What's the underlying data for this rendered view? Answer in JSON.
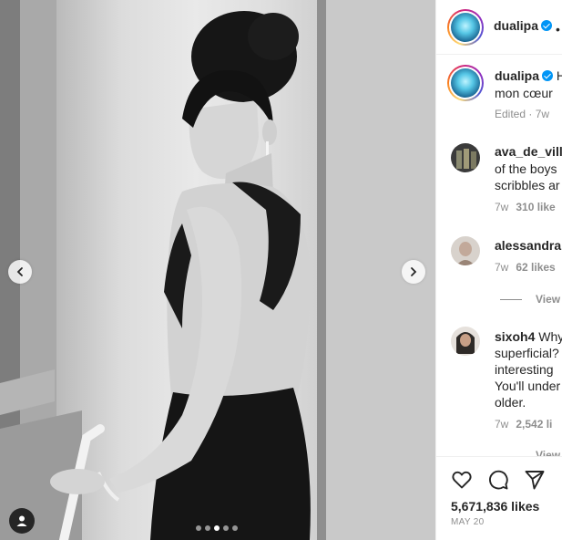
{
  "post": {
    "author": "dualipa",
    "verified": true,
    "more_glyph": "•",
    "media_dots": 5,
    "active_dot": 2
  },
  "caption": {
    "username": "dualipa",
    "first_letter": "H",
    "line2": "mon cœur",
    "edited": "Edited",
    "time": "7w"
  },
  "comments": [
    {
      "username": "ava_de_ville",
      "lines": [
        "of the boys",
        "scribbles ar"
      ],
      "time": "7w",
      "likes": "310 like"
    },
    {
      "username": "alessandra",
      "lines": [],
      "time": "7w",
      "likes": "62 likes",
      "view_replies": "View"
    },
    {
      "username": "sixoh4",
      "first_word": "Why",
      "lines": [
        "superficial?",
        "interesting",
        "You'll under",
        "older."
      ],
      "time": "7w",
      "likes": "2,542 li",
      "view_replies": "View"
    }
  ],
  "footer": {
    "likes": "5,671,836 likes",
    "date": "MAY 20"
  },
  "icons": {
    "prev": "chevron-left-icon",
    "next": "chevron-right-icon",
    "tag": "user-tag-icon",
    "like": "heart-icon",
    "comment": "comment-icon",
    "share": "paper-plane-icon"
  },
  "colors": {
    "verified": "#0095f6",
    "text": "#262626",
    "muted": "#8e8e8e",
    "divider": "#efefef"
  }
}
